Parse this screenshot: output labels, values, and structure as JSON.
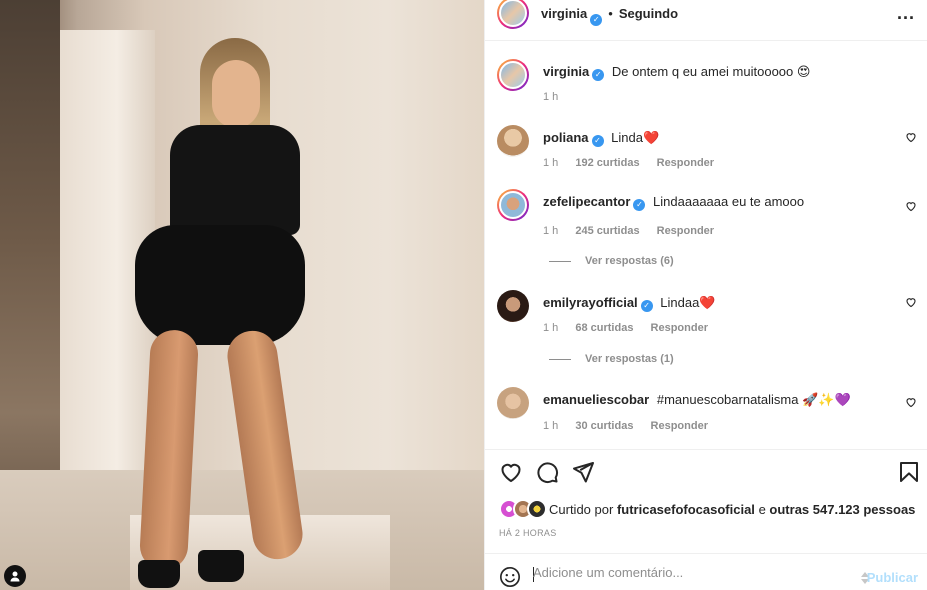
{
  "post": {
    "author": "virginia",
    "follow_separator": "•",
    "follow_status": "Seguindo",
    "more_label": "...",
    "caption": "De ontem q eu amei muitooooo 😍",
    "caption_time": "1 h"
  },
  "comments": [
    {
      "user": "poliana",
      "verified": true,
      "text": "Linda❤️",
      "time": "1 h",
      "likes": "192 curtidas",
      "reply": "Responder",
      "replies": ""
    },
    {
      "user": "zefelipecantor",
      "verified": true,
      "text": "Lindaaaaaaa eu te amooo",
      "time": "1 h",
      "likes": "245 curtidas",
      "reply": "Responder",
      "replies": "Ver respostas (6)"
    },
    {
      "user": "emilyrayofficial",
      "verified": true,
      "text": "Lindaa❤️",
      "time": "1 h",
      "likes": "68 curtidas",
      "reply": "Responder",
      "replies": "Ver respostas (1)"
    },
    {
      "user": "emanueliescobar",
      "verified": false,
      "hashtag": "#manuescobarnatalisma",
      "text": "🚀✨💜",
      "time": "1 h",
      "likes": "30 curtidas",
      "reply": "Responder",
      "replies": ""
    }
  ],
  "likes": {
    "prefix": "Curtido por",
    "user": "futricasefofocasoficial",
    "middle": "e",
    "others": "outras 547.123 pessoas"
  },
  "posted_ago": "HÁ 2 HORAS",
  "composer": {
    "placeholder": "Adicione um comentário...",
    "publish_label": "Publicar"
  },
  "colors": {
    "verified": "#3897f0",
    "heart_red": "#ed4956",
    "publish_disabled": "#b2dffc",
    "link": "#00376b"
  },
  "icons": [
    "heart-icon",
    "comment-icon",
    "share-icon",
    "bookmark-icon",
    "emoji-icon",
    "more-icon",
    "tag-user-icon",
    "verified-icon"
  ]
}
